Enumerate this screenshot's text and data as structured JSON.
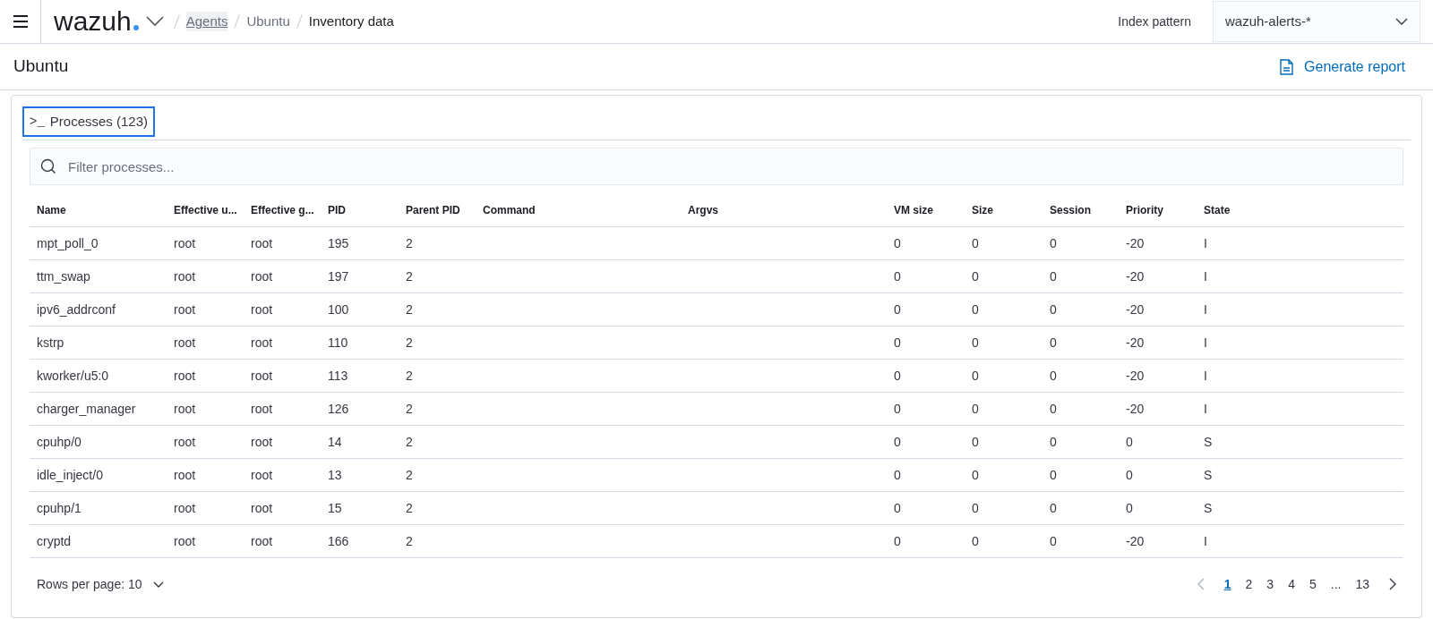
{
  "header": {
    "logo": "wazuh",
    "breadcrumbs": [
      {
        "label": "Agents",
        "kind": "link"
      },
      {
        "label": "Ubuntu",
        "kind": "link"
      },
      {
        "label": "Inventory data",
        "kind": "current"
      }
    ],
    "index_pattern_label": "Index pattern",
    "index_pattern": "wazuh-alerts-*"
  },
  "title": "Ubuntu",
  "report_button": "Generate report",
  "tab": {
    "prompt": ">_",
    "label": "Processes (123)",
    "selected": true
  },
  "filter": {
    "placeholder": "Filter processes..."
  },
  "table": {
    "columns": [
      "Name",
      "Effective u...",
      "Effective g...",
      "PID",
      "Parent PID",
      "Command",
      "Argvs",
      "VM size",
      "Size",
      "Session",
      "Priority",
      "State"
    ],
    "rows": [
      [
        "mpt_poll_0",
        "root",
        "root",
        "195",
        "2",
        "",
        "",
        "0",
        "0",
        "0",
        "-20",
        "I"
      ],
      [
        "ttm_swap",
        "root",
        "root",
        "197",
        "2",
        "",
        "",
        "0",
        "0",
        "0",
        "-20",
        "I"
      ],
      [
        "ipv6_addrconf",
        "root",
        "root",
        "100",
        "2",
        "",
        "",
        "0",
        "0",
        "0",
        "-20",
        "I"
      ],
      [
        "kstrp",
        "root",
        "root",
        "110",
        "2",
        "",
        "",
        "0",
        "0",
        "0",
        "-20",
        "I"
      ],
      [
        "kworker/u5:0",
        "root",
        "root",
        "113",
        "2",
        "",
        "",
        "0",
        "0",
        "0",
        "-20",
        "I"
      ],
      [
        "charger_manager",
        "root",
        "root",
        "126",
        "2",
        "",
        "",
        "0",
        "0",
        "0",
        "-20",
        "I"
      ],
      [
        "cpuhp/0",
        "root",
        "root",
        "14",
        "2",
        "",
        "",
        "0",
        "0",
        "0",
        "0",
        "S"
      ],
      [
        "idle_inject/0",
        "root",
        "root",
        "13",
        "2",
        "",
        "",
        "0",
        "0",
        "0",
        "0",
        "S"
      ],
      [
        "cpuhp/1",
        "root",
        "root",
        "15",
        "2",
        "",
        "",
        "0",
        "0",
        "0",
        "0",
        "S"
      ],
      [
        "cryptd",
        "root",
        "root",
        "166",
        "2",
        "",
        "",
        "0",
        "0",
        "0",
        "-20",
        "I"
      ]
    ]
  },
  "rows_per_page": "Rows per page: 10",
  "pagination": {
    "pages": [
      {
        "label": "1",
        "selected": true
      },
      {
        "label": "2",
        "selected": false
      },
      {
        "label": "3",
        "selected": false
      },
      {
        "label": "4",
        "selected": false
      },
      {
        "label": "5",
        "selected": false
      },
      {
        "label": "...",
        "selected": false
      },
      {
        "label": "13",
        "selected": false
      }
    ]
  }
}
